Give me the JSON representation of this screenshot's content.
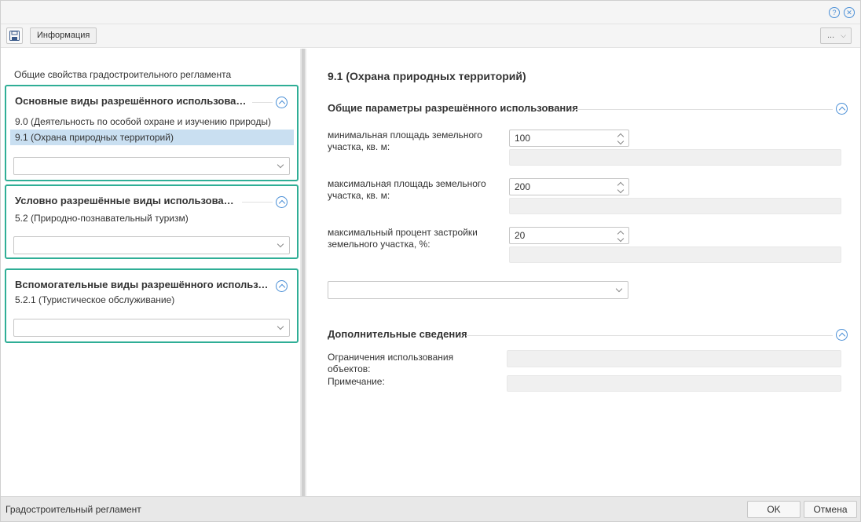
{
  "toolbar": {
    "save_icon": "save-icon",
    "info_label": "Информация",
    "more_label": "..."
  },
  "titlebar": {
    "help_icon": "help-icon",
    "close_icon": "close-icon"
  },
  "left": {
    "caption": "Общие свойства градостроительного регламента",
    "groups": [
      {
        "title": "Основные виды разрешённого использования",
        "items": [
          {
            "label": "9.0 (Деятельность по особой охране и изучению природы)",
            "selected": false
          },
          {
            "label": "9.1 (Охрана природных территорий)",
            "selected": true
          }
        ],
        "combo_value": ""
      },
      {
        "title": "Условно разрешённые виды использования",
        "items": [
          {
            "label": "5.2 (Природно-познавательный туризм)",
            "selected": false
          }
        ],
        "combo_value": ""
      },
      {
        "title": "Вспомогательные виды разрешённого использования",
        "items": [
          {
            "label": "5.2.1 (Туристическое обслуживание)",
            "selected": false
          }
        ],
        "combo_value": ""
      }
    ]
  },
  "right": {
    "title": "9.1 (Охрана природных территорий)",
    "section1": {
      "title": "Общие параметры разрешённого использования",
      "fields": [
        {
          "label": "минимальная площадь земельного участка, кв. м:",
          "value": "100"
        },
        {
          "label": "максимальная площадь земельного участка, кв. м:",
          "value": "200"
        },
        {
          "label": "максимальный процент застройки земельного участка, %:",
          "value": "20"
        }
      ],
      "combo_value": ""
    },
    "section2": {
      "title": "Дополнительные сведения",
      "fields": [
        {
          "label": "Ограничения использования объектов:",
          "value": ""
        },
        {
          "label": "Примечание:",
          "value": ""
        }
      ]
    }
  },
  "footer": {
    "title": "Градостроительный регламент",
    "ok_label": "OK",
    "cancel_label": "Отмена"
  },
  "colors": {
    "accent": "#2fae96",
    "icon_blue": "#4a8fd6",
    "selection": "#c9dff1"
  }
}
